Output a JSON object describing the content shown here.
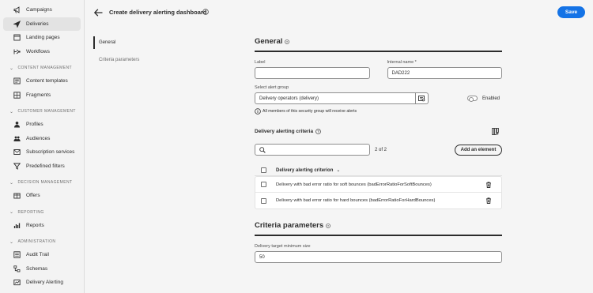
{
  "sidebar": {
    "top_items": [
      {
        "label": "Campaigns",
        "icon": "megaphone-icon"
      },
      {
        "label": "Deliveries",
        "icon": "send-icon",
        "active": true
      },
      {
        "label": "Landing pages",
        "icon": "landing-page-icon"
      },
      {
        "label": "Workflows",
        "icon": "workflow-icon"
      }
    ],
    "sections": [
      {
        "title": "CONTENT MANAGEMENT",
        "items": [
          {
            "label": "Content templates",
            "icon": "template-icon"
          },
          {
            "label": "Fragments",
            "icon": "fragment-icon"
          }
        ]
      },
      {
        "title": "CUSTOMER MANAGEMENT",
        "items": [
          {
            "label": "Profiles",
            "icon": "user-icon"
          },
          {
            "label": "Audiences",
            "icon": "audience-icon"
          },
          {
            "label": "Subscription services",
            "icon": "subscription-icon"
          },
          {
            "label": "Predefined filters",
            "icon": "filter-icon"
          }
        ]
      },
      {
        "title": "DECISION MANAGEMENT",
        "items": [
          {
            "label": "Offers",
            "icon": "offers-icon"
          }
        ]
      },
      {
        "title": "REPORTING",
        "items": [
          {
            "label": "Reports",
            "icon": "chart-icon"
          }
        ]
      },
      {
        "title": "ADMINISTRATION",
        "items": [
          {
            "label": "Audit Trail",
            "icon": "audit-icon"
          },
          {
            "label": "Schemas",
            "icon": "schema-icon"
          },
          {
            "label": "Delivery Alerting",
            "icon": "alert-icon"
          }
        ]
      }
    ]
  },
  "header": {
    "title": "Create delivery alerting dashboard",
    "save_label": "Save"
  },
  "subnav": {
    "items": [
      "General",
      "Criteria parameters"
    ]
  },
  "general": {
    "title": "General",
    "label_field": {
      "label": "Label",
      "value": ""
    },
    "internal_name": {
      "label": "Internal name",
      "required_mark": "*",
      "value": "DAD222"
    },
    "alert_group": {
      "label": "Select alert group",
      "value": "Delivery operators (delivery)"
    },
    "enabled_label": "Enabled",
    "info_text": "All members of this security group will receive alerts"
  },
  "criteria": {
    "title": "Delivery alerting criteria",
    "search_placeholder": "",
    "count_text": "2 of 2",
    "add_label": "Add an element",
    "column_header": "Delivery alerting criterion",
    "rows": [
      "Delivery with bad error ratio for soft bounces (badErrorRatioForSoftBounces)",
      "Delivery with bad error ratio for hard bounces (badErrorRatioForHardBounces)"
    ]
  },
  "params": {
    "title": "Criteria parameters",
    "min_size_label": "Delivery target minimum size",
    "min_size_value": "50"
  },
  "colors": {
    "accent": "#1473e6",
    "text": "#2c2c2c",
    "background": "#f5f5f5"
  }
}
